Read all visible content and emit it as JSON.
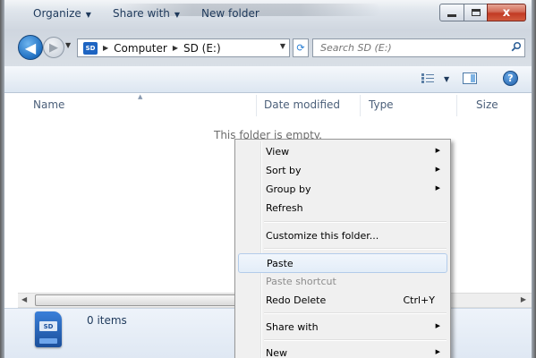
{
  "window": {
    "minimize_glyph": "min",
    "maximize_glyph": "max",
    "close_glyph": "x"
  },
  "navigation": {
    "back_glyph": "◀",
    "forward_glyph": "▶",
    "dropdown_glyph": "▼",
    "address": {
      "drive_icon_text": "SD",
      "crumbs": [
        "Computer",
        "SD (E:)"
      ],
      "separator": "▶",
      "dropdown_glyph": "▼"
    },
    "refresh_glyph": "⟳",
    "search_placeholder": "Search SD (E:)"
  },
  "toolbar": {
    "organize": "Organize",
    "share_with": "Share with",
    "new_folder": "New folder",
    "dropdown_glyph": "▼",
    "help_glyph": "?"
  },
  "columns": {
    "name": "Name",
    "date_modified": "Date modified",
    "type": "Type",
    "size": "Size",
    "sort_glyph": "▲"
  },
  "content": {
    "empty_message": "This folder is empty."
  },
  "scrollbar": {
    "left_glyph": "◀",
    "right_glyph": "▶"
  },
  "status": {
    "drive_icon_text": "SD",
    "items": "0 items"
  },
  "context_menu": {
    "submenu_glyph": "▶",
    "items": [
      {
        "label": "View",
        "submenu": true
      },
      {
        "label": "Sort by",
        "submenu": true
      },
      {
        "label": "Group by",
        "submenu": true
      },
      {
        "label": "Refresh"
      },
      {
        "label": "Customize this folder..."
      },
      {
        "label": "Paste",
        "highlighted": true
      },
      {
        "label": "Paste shortcut",
        "disabled": true
      },
      {
        "label": "Redo Delete",
        "shortcut": "Ctrl+Y"
      },
      {
        "label": "Share with",
        "submenu": true
      },
      {
        "label": "New",
        "submenu": true
      }
    ]
  },
  "colors": {
    "accent": "#1e395b",
    "menu_highlight_border": "#b3ccea",
    "close_button": "#c23a24"
  }
}
